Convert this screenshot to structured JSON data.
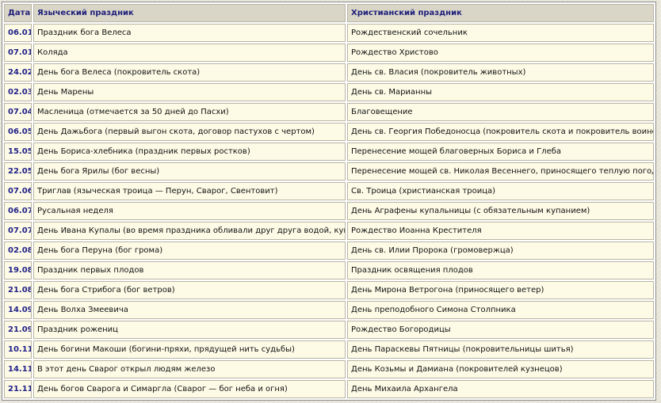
{
  "table": {
    "headers": {
      "date": "Дата",
      "pagan": "Языческий праздник",
      "christian": "Христианский праздник"
    },
    "rows": [
      {
        "date": "06.01",
        "pagan": "Праздник бога Велеса",
        "christian": "Рождественский сочельник"
      },
      {
        "date": "07.01",
        "pagan": "Коляда",
        "christian": "Рождество Христово"
      },
      {
        "date": "24.02",
        "pagan": "День бога Велеса (покровитель скота)",
        "christian": "День св. Власия (покровитель животных)"
      },
      {
        "date": "02.03",
        "pagan": "День Марены",
        "christian": "День св. Марианны"
      },
      {
        "date": "07.04",
        "pagan": "Масленица (отмечается за 50 дней до Пасхи)",
        "christian": "Благовещение"
      },
      {
        "date": "06.05",
        "pagan": "День Дажьбога (первый выгон скота, договор пастухов с чертом)",
        "christian": "День св. Георгия Победоносца (покровитель скота и покровитель воинов)"
      },
      {
        "date": "15.05",
        "pagan": "День Бориса-хлебника (праздник первых ростков)",
        "christian": "Перенесение мощей благоверных Бориса и Глеба"
      },
      {
        "date": "22.05",
        "pagan": "День бога Ярилы (бог весны)",
        "christian": "Перенесение мощей св. Николая Весеннего, приносящего теплую погоду"
      },
      {
        "date": "07.06",
        "pagan": "Триглав (языческая троица — Перун, Сварог, Свентовит)",
        "christian": "Св. Троица (христианская троица)"
      },
      {
        "date": "06.07",
        "pagan": "Русальная неделя",
        "christian": "День Аграфены купальницы (с обязательным купанием)"
      },
      {
        "date": "07.07",
        "pagan": "День Ивана Купалы (во время праздника обливали друг друга водой, купались)",
        "christian": "Рождество Иоанна Крестителя"
      },
      {
        "date": "02.08",
        "pagan": "День бога Перуна (бог грома)",
        "christian": "День св. Илии Пророка (громовержца)"
      },
      {
        "date": "19.08",
        "pagan": "Праздник первых плодов",
        "christian": "Праздник освящения плодов"
      },
      {
        "date": "21.08",
        "pagan": "День бога Стрибога (бог ветров)",
        "christian": "День Мирона Ветрогона (приносящего ветер)"
      },
      {
        "date": "14.09",
        "pagan": "День Волха Змеевича",
        "christian": "День преподобного Симона Столпника"
      },
      {
        "date": "21.09",
        "pagan": "Праздник рожениц",
        "christian": "Рождество Богородицы"
      },
      {
        "date": "10.11",
        "pagan": "День богини Макоши (богини-пряхи, прядущей нить судьбы)",
        "christian": "День Параскевы Пятницы (покровительницы шитья)"
      },
      {
        "date": "14.11",
        "pagan": "В этот день Сварог открыл людям железо",
        "christian": "День Козьмы и Дамиана (покровителей кузнецов)"
      },
      {
        "date": "21.11",
        "pagan": "День богов Сварога и Симаргла (Сварог — бог неба и огня)",
        "christian": "День Михаила Архангела"
      }
    ]
  }
}
